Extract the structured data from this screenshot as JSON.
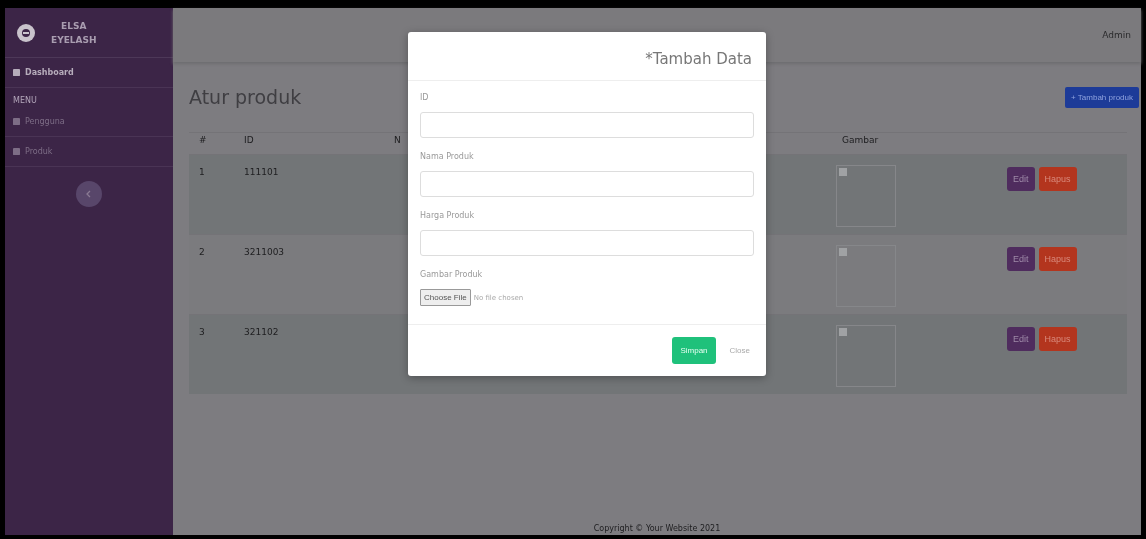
{
  "sidebar": {
    "brand": [
      "ELSA",
      "EYELASH"
    ],
    "items": [
      {
        "kind": "link",
        "label": "Dashboard",
        "selected": true
      },
      {
        "kind": "heading",
        "label": "MENU"
      },
      {
        "kind": "link",
        "label": "Pengguna",
        "selected": false
      },
      {
        "kind": "link",
        "label": "Produk",
        "selected": false
      }
    ]
  },
  "topbar": {
    "user": "Admin"
  },
  "page": {
    "title": "Atur produk",
    "add_button": "+ Tambah produk"
  },
  "table": {
    "columns": [
      "#",
      "ID",
      "N",
      "Gambar"
    ],
    "rows": [
      {
        "number": "1",
        "id": "111101",
        "actions": [
          "Edit",
          "Hapus"
        ]
      },
      {
        "number": "2",
        "id": "3211003",
        "actions": [
          "Edit",
          "Hapus"
        ]
      },
      {
        "number": "3",
        "id": "321102",
        "actions": [
          "Edit",
          "Hapus"
        ]
      }
    ]
  },
  "modal": {
    "title": "*Tambah Data",
    "fields": [
      {
        "kind": "text",
        "label": "ID"
      },
      {
        "kind": "text",
        "label": "Nama Produk"
      },
      {
        "kind": "text",
        "label": "Harga Produk"
      },
      {
        "kind": "file",
        "label": "Gambar Produk",
        "button": "Choose File",
        "status": "No file chosen"
      }
    ],
    "buttons": [
      {
        "kind": "primary",
        "label": "Simpan"
      },
      {
        "kind": "link",
        "label": "Close"
      }
    ]
  },
  "footer": "Copyright © Your Website 2021"
}
